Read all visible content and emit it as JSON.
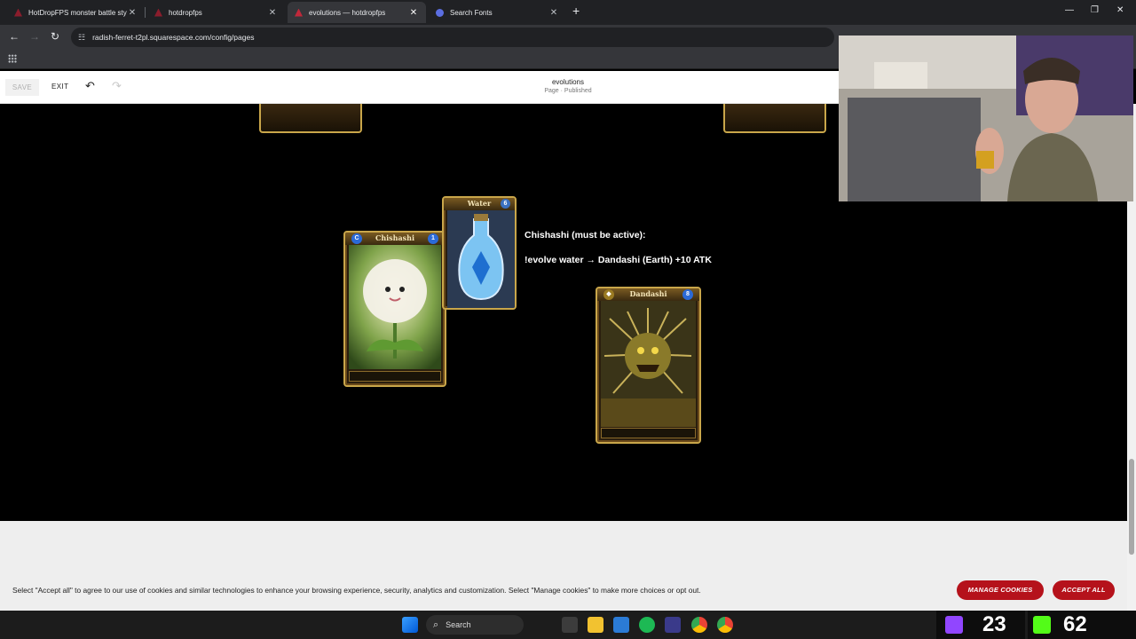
{
  "browser": {
    "tabs": [
      {
        "title": "HotDropFPS monster battle sty",
        "active": false
      },
      {
        "title": "hotdropfps",
        "active": false
      },
      {
        "title": "evolutions — hotdropfps",
        "active": true
      },
      {
        "title": "Search Fonts",
        "active": false
      }
    ],
    "url": "radish-ferret-t2pl.squarespace.com/config/pages"
  },
  "editor": {
    "save_label": "SAVE",
    "exit_label": "EXIT",
    "page_title": "evolutions",
    "page_status": "Page · Published"
  },
  "cards": {
    "chishashi": {
      "name": "Chishashi",
      "level": "1"
    },
    "water": {
      "name": "Water",
      "level": "6"
    },
    "dandashi": {
      "name": "Dandashi",
      "level": "8"
    }
  },
  "evolution": {
    "requirement": "Chishashi (must be active):",
    "command": "!evolve water → Dandashi (Earth) +10 ATK"
  },
  "cookie_banner": {
    "text": "Select \"Accept all\" to agree to our use of cookies and similar technologies to enhance your browsing experience, security, analytics and customization. Select \"Manage cookies\" to make more choices or opt out.",
    "manage_label": "MANAGE COOKIES",
    "accept_label": "ACCEPT ALL"
  },
  "taskbar": {
    "search_label": "Search",
    "stat_left": "23",
    "stat_right": "62"
  },
  "colors": {
    "accent_red": "#b5121b",
    "card_gold": "#c9a64a"
  }
}
